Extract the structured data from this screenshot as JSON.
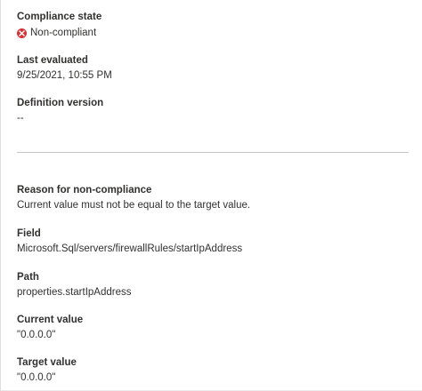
{
  "compliance": {
    "label": "Compliance state",
    "status_text": "Non-compliant",
    "status_icon": "error-circle-icon",
    "status_color": "#d13438"
  },
  "last_evaluated": {
    "label": "Last evaluated",
    "value": "9/25/2021, 10:55 PM"
  },
  "definition_version": {
    "label": "Definition version",
    "value": "--"
  },
  "reason": {
    "label": "Reason for non-compliance",
    "value": "Current value must not be equal to the target value."
  },
  "field": {
    "label": "Field",
    "value": "Microsoft.Sql/servers/firewallRules/startIpAddress"
  },
  "path": {
    "label": "Path",
    "value": "properties.startIpAddress"
  },
  "current_value": {
    "label": "Current value",
    "value": "\"0.0.0.0\""
  },
  "target_value": {
    "label": "Target value",
    "value": "\"0.0.0.0\""
  }
}
